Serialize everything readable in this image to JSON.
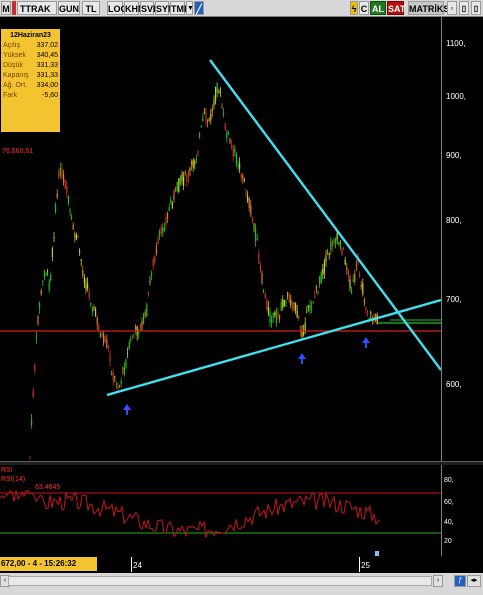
{
  "toolbar": {
    "m_label": "M",
    "symbol": "TTRAK",
    "period": "GUN",
    "currency": "TL",
    "log": "LOG",
    "khn": "KHN",
    "svd": "SVD",
    "sym": "SYM",
    "tmp": "TMP",
    "c_label": "C",
    "al_label": "AL",
    "sat_label": "SAT",
    "matriks_label": "MATRİKS"
  },
  "info_box": {
    "date": "12Haziran23",
    "rows": [
      {
        "label": "Açılış",
        "value": "337,02"
      },
      {
        "label": "Yüksek",
        "value": "340,45"
      },
      {
        "label": "Düşük",
        "value": "331,33"
      },
      {
        "label": "Kapanış",
        "value": "331,33"
      },
      {
        "label": "Ağ. Ort.",
        "value": "334,00"
      },
      {
        "label": "Fark",
        "value": "-5,60"
      }
    ]
  },
  "ref_label": "76.660,61",
  "price_axis": [
    "1100,",
    "1000,",
    "900,",
    "800,",
    "700,",
    "600,"
  ],
  "rsi": {
    "title": "RSI",
    "params": "RSI(14)",
    "value": "63.4645",
    "axis": [
      "80,",
      "60,",
      "40,",
      "20"
    ]
  },
  "status": "672,00 - 4 - 15:26:32",
  "dates": [
    "24",
    "25"
  ],
  "colors": {
    "support_line": "#40e0f0",
    "resistance_line": "#40e0f0",
    "horizontal_red": "#d02020",
    "rsi_line": "#c01818",
    "info_bg": "#f4c430"
  }
}
